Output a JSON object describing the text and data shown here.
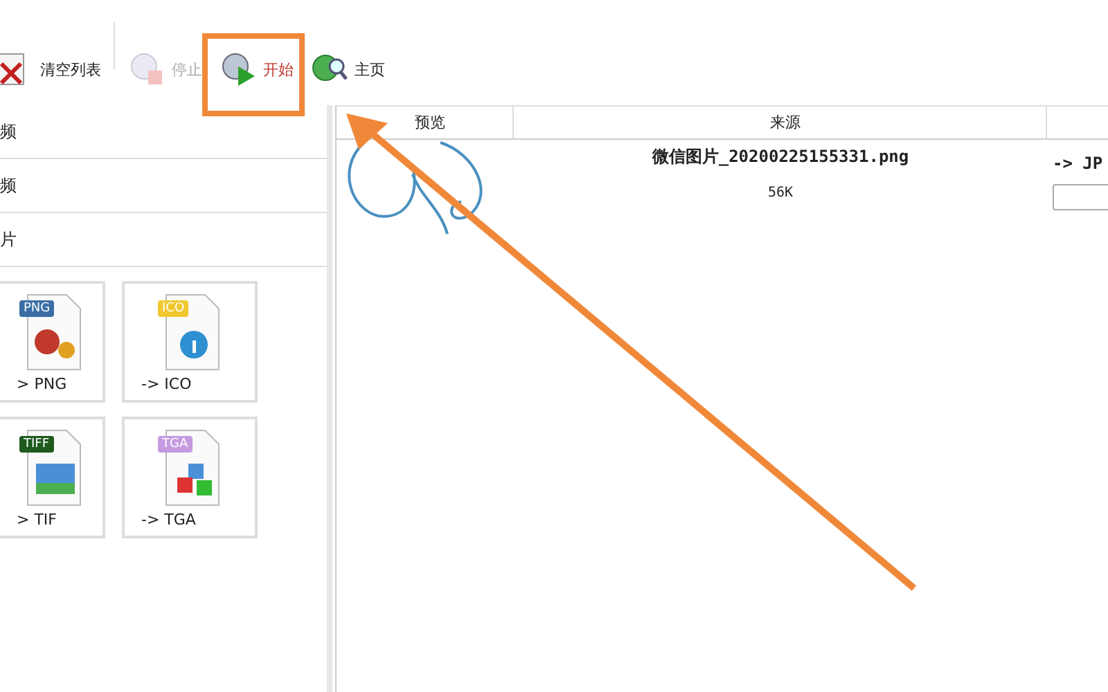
{
  "toolbar": [
    {
      "kind": "clear",
      "label": "清空列表",
      "disabled": false
    },
    {
      "kind": "stop",
      "label": "停止",
      "disabled": true
    },
    {
      "kind": "start",
      "label": "开始",
      "disabled": false
    },
    {
      "kind": "home",
      "label": "主页",
      "disabled": false
    }
  ],
  "categories": [
    {
      "label": "频"
    },
    {
      "label": "频"
    },
    {
      "label": "片"
    }
  ],
  "tiles": [
    {
      "badge": "PNG",
      "label": "> PNG",
      "color": "#3a6ea5",
      "kind": "flower"
    },
    {
      "badge": "ICO",
      "label": "-> ICO",
      "color": "#f0c830",
      "kind": "info"
    },
    {
      "badge": "TIFF",
      "label": "> TIF",
      "color": "#1e5a1e",
      "kind": "landscape"
    },
    {
      "badge": "TGA",
      "label": "-> TGA",
      "color": "#c49be0",
      "kind": "cubes"
    }
  ],
  "table": {
    "columns": [
      "预览",
      "来源"
    ],
    "rows": [
      {
        "filename": "微信图片_20200225155331.png",
        "size": "56K",
        "output": "-> JP"
      }
    ]
  }
}
